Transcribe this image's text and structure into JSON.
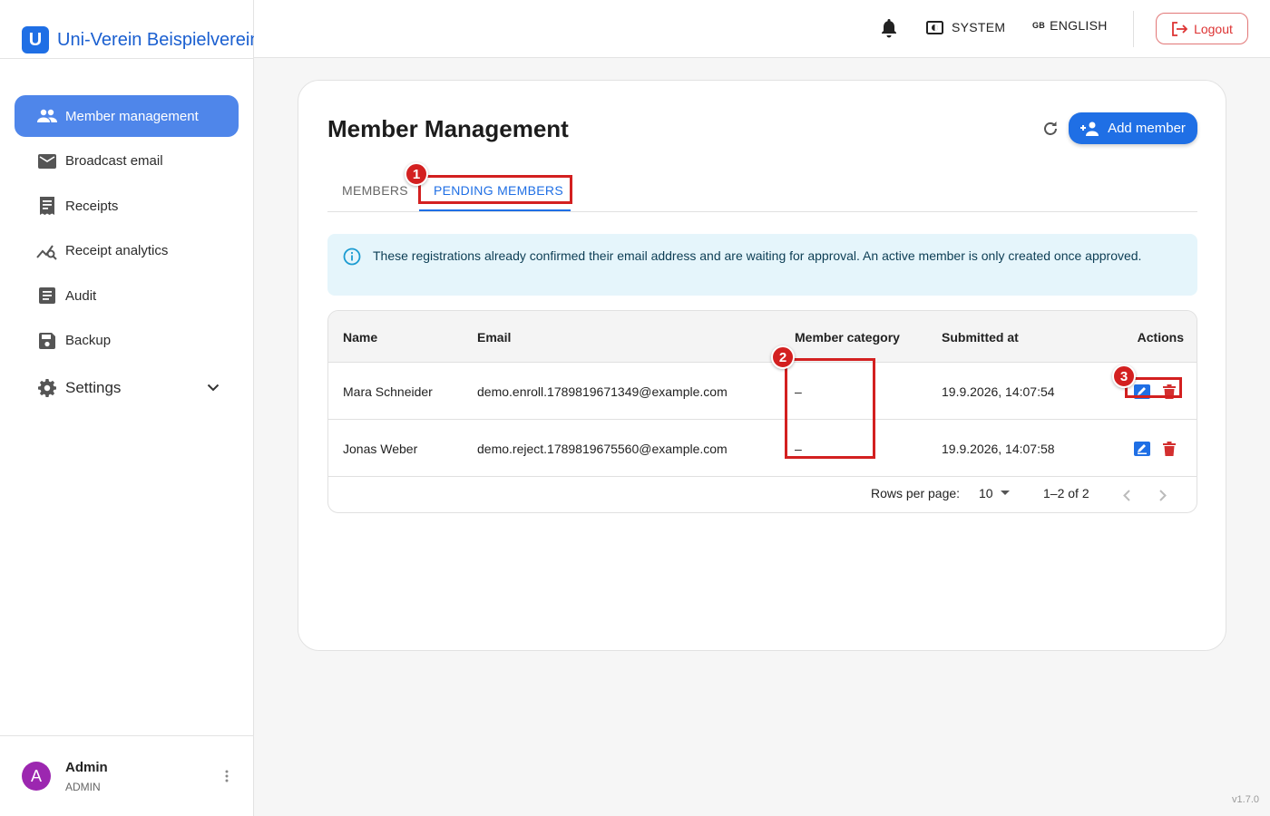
{
  "brand": {
    "letter": "U",
    "name": "Uni-Verein Beispielverein"
  },
  "nav": {
    "items": [
      {
        "label": "Member management",
        "icon": "people-icon"
      },
      {
        "label": "Broadcast email",
        "icon": "mail-icon"
      },
      {
        "label": "Receipts",
        "icon": "receipt-icon"
      },
      {
        "label": "Receipt analytics",
        "icon": "analytics-icon"
      },
      {
        "label": "Audit",
        "icon": "audit-icon"
      },
      {
        "label": "Backup",
        "icon": "save-icon"
      }
    ],
    "settings_label": "Settings"
  },
  "user": {
    "initial": "A",
    "name": "Admin",
    "role": "ADMIN"
  },
  "topbar": {
    "system_label": "SYSTEM",
    "lang_flag": "GB",
    "lang_label": "ENGLISH",
    "logout_label": "Logout"
  },
  "page": {
    "title": "Member Management",
    "add_member_label": "Add member",
    "tabs": [
      {
        "label": "MEMBERS"
      },
      {
        "label": "PENDING MEMBERS"
      }
    ],
    "info_text": "These registrations already confirmed their email address and are waiting for approval. An active member is only created once approved."
  },
  "table": {
    "columns": [
      "Name",
      "Email",
      "Member category",
      "Submitted at",
      "Actions"
    ],
    "rows": [
      {
        "name": "Mara Schneider",
        "email": "demo.enroll.1789819671349@example.com",
        "category": "–",
        "submitted": "19.9.2026, 14:07:54"
      },
      {
        "name": "Jonas Weber",
        "email": "demo.reject.1789819675560@example.com",
        "category": "–",
        "submitted": "19.9.2026, 14:07:58"
      }
    ],
    "rows_per_page_label": "Rows per page:",
    "rows_per_page": "10",
    "range": "1–2 of 2"
  },
  "annotations": [
    {
      "number": "1"
    },
    {
      "number": "2"
    },
    {
      "number": "3"
    }
  ],
  "version": "v1.7.0",
  "colors": {
    "primary": "#1f6fe5",
    "nav_active": "#4f86ea",
    "danger": "#d32f2f",
    "info_bg": "#e5f5fb",
    "avatar": "#9c27b0"
  }
}
